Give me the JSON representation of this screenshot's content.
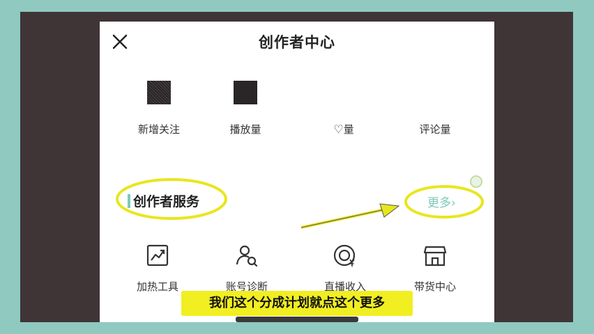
{
  "header": {
    "title": "创作者中心",
    "close_icon": "close-icon"
  },
  "stats": [
    {
      "label": "新增关注"
    },
    {
      "label": "播放量"
    },
    {
      "label": "量",
      "icon": "heart-icon"
    },
    {
      "label": "评论量"
    }
  ],
  "section": {
    "title": "创作者服务",
    "more_label": "更多",
    "more_chevron": "›"
  },
  "services": [
    {
      "label": "加热工具",
      "icon": "chart-trend-icon"
    },
    {
      "label": "账号诊断",
      "icon": "user-search-icon"
    },
    {
      "label": "直播收入",
      "icon": "live-income-icon"
    },
    {
      "label": "带货中心",
      "icon": "store-icon"
    }
  ],
  "subtitle": "我们这个分成计划就点这个更多",
  "colors": {
    "accent": "#7ec8b9",
    "highlight": "#e8e61e",
    "background": "#8fc9c0"
  }
}
